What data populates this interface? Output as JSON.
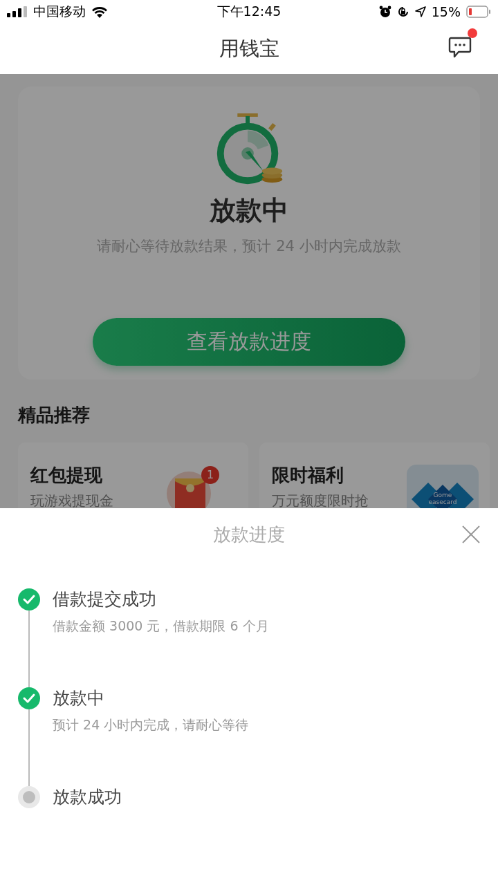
{
  "status_bar": {
    "carrier": "中国移动",
    "time": "下午12:45",
    "battery": "15%"
  },
  "header": {
    "title": "用钱宝",
    "has_unread": true
  },
  "status_card": {
    "title": "放款中",
    "subtitle": "请耐心等待放款结果，预计 24 小时内完成放款",
    "button": "查看放款进度"
  },
  "recommend": {
    "heading": "精品推荐",
    "cards": [
      {
        "kind": "redpacket",
        "title": "红包提现",
        "subtitle": "玩游戏提现金",
        "badge": "1"
      },
      {
        "kind": "logo",
        "title": "限时福利",
        "subtitle": "万元额度限时抢",
        "logo_text": [
          "Gome",
          "easecard"
        ]
      }
    ]
  },
  "sheet": {
    "title": "放款进度",
    "steps": [
      {
        "title": "借款提交成功",
        "detail": "借款金额 3000 元，借款期限 6 个月",
        "done": true
      },
      {
        "title": "放款中",
        "detail": "预计 24 小时内完成，请耐心等待",
        "done": true
      },
      {
        "title": "放款成功",
        "done": false
      }
    ]
  }
}
